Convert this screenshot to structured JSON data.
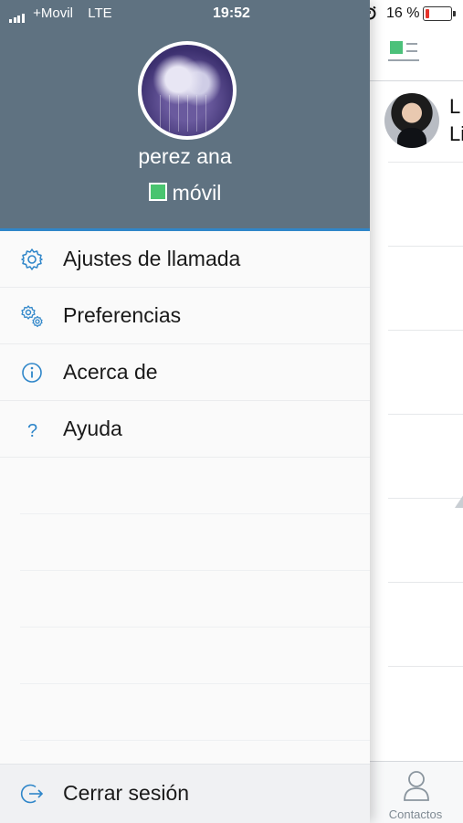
{
  "status_bar": {
    "carrier": "+Movil",
    "network": "LTE",
    "time": "19:52",
    "battery_percent": "16 %"
  },
  "profile": {
    "name": "perez ana",
    "presence": "móvil",
    "presence_color": "#49c46f"
  },
  "menu": {
    "items": [
      {
        "label": "Ajustes de llamada",
        "icon": "gear-icon"
      },
      {
        "label": "Preferencias",
        "icon": "gears-icon"
      },
      {
        "label": "Acerca de",
        "icon": "info-icon"
      },
      {
        "label": "Ayuda",
        "icon": "help-icon"
      }
    ],
    "logout_label": "Cerrar sesión"
  },
  "main": {
    "contact": {
      "line1": "L",
      "line2": "Li"
    },
    "tab_contacts_label": "Contactos"
  },
  "colors": {
    "header_bg": "#5f7281",
    "accent": "#2f86c9"
  }
}
